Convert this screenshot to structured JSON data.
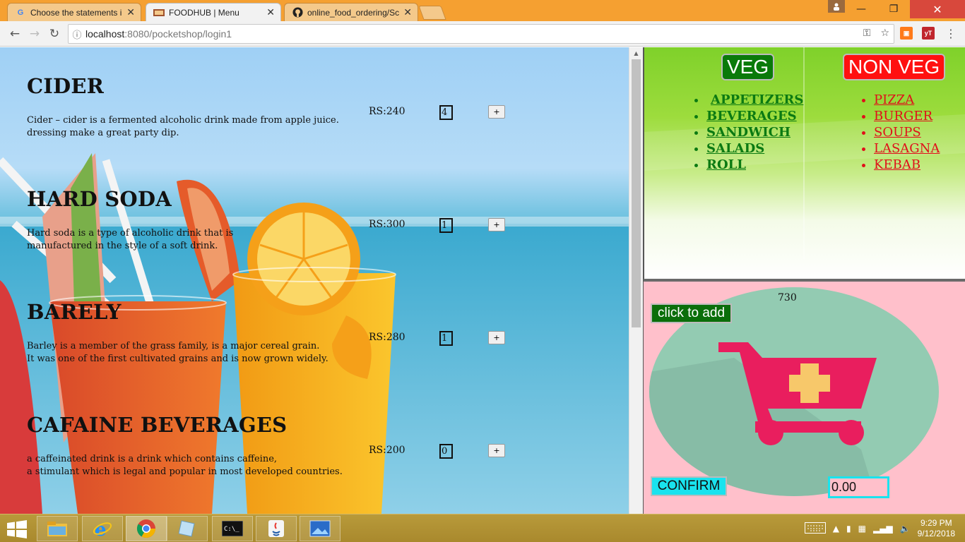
{
  "browser": {
    "tabs": [
      {
        "title": "Choose the statements in",
        "favicon": "google-icon"
      },
      {
        "title": "FOODHUB | Menu",
        "favicon": "foodhub-icon",
        "active": true
      },
      {
        "title": "online_food_ordering/Scr",
        "favicon": "github-icon"
      }
    ],
    "close_glyph": "✕",
    "address": {
      "host": "localhost",
      "path": ":8080/pocketshop/login1"
    },
    "window_buttons": {
      "minimize": "—",
      "maximize": "❐",
      "close": "✕"
    }
  },
  "menu_items": [
    {
      "name": "CIDER",
      "desc_lines": [
        "Cider – cider is a fermented alcoholic drink made from apple juice.",
        "dressing make a great party dip."
      ],
      "price": "RS:240",
      "qty": "4",
      "add_label": "+"
    },
    {
      "name": "HARD SODA",
      "desc_lines": [
        "Hard soda is a type of alcoholic drink that is",
        "manufactured in the style of a soft drink."
      ],
      "price": "RS:300",
      "qty": "1",
      "add_label": "+"
    },
    {
      "name": "BARELY",
      "desc_lines": [
        "Barley is a member of the grass family, is a major cereal grain.",
        "It was one of the first cultivated grains and is now grown widely."
      ],
      "price": "RS:280",
      "qty": "1",
      "add_label": "+"
    },
    {
      "name": "CAFAINE BEVERAGES",
      "desc_lines": [
        "a caffeinated drink is a drink which contains caffeine,",
        "a stimulant which is legal and popular in most developed countries."
      ],
      "price": "RS:200",
      "qty": "0",
      "add_label": "+"
    }
  ],
  "categories": {
    "veg": {
      "label": "VEG",
      "color": "#0a7a0a",
      "items": [
        "APPETIZERS",
        "BEVERAGES",
        "SANDWICH",
        "SALADS",
        "ROLL"
      ]
    },
    "nonveg": {
      "label": "NON VEG",
      "color": "#ff1010",
      "items": [
        "PIZZA",
        "BURGER",
        "SOUPS",
        "LASAGNA",
        "KEBAB"
      ]
    }
  },
  "cart": {
    "add_label": "click to add",
    "count": "730",
    "confirm_label": "CONFIRM",
    "total": "0.00",
    "icon": "shopping-cart-plus-icon",
    "colors": {
      "background": "#ffc0cb",
      "circle": "#93cbb2",
      "cart": "#e91e63",
      "plus": "#f7c86a"
    }
  },
  "taskbar": {
    "apps": [
      "file-explorer-icon",
      "internet-explorer-icon",
      "chrome-icon",
      "notes-icon",
      "command-prompt-icon",
      "java-icon",
      "image-viewer-icon"
    ],
    "time": "9:29 PM",
    "date": "9/12/2018"
  }
}
